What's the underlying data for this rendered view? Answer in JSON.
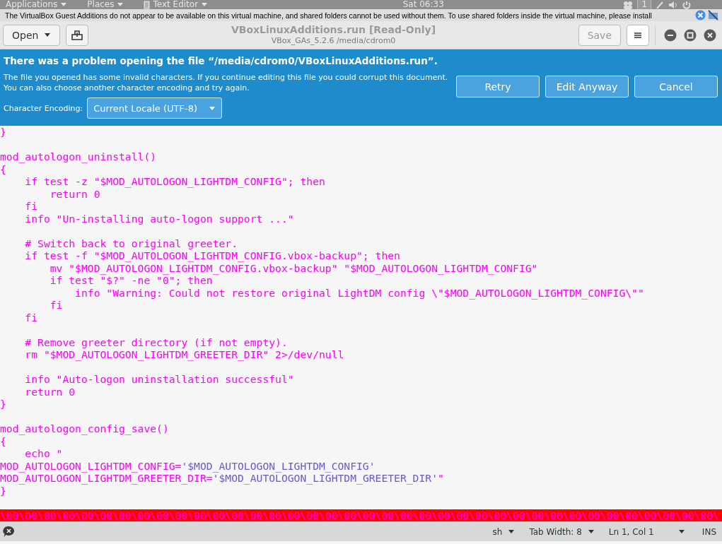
{
  "top_bar": {
    "menus": [
      {
        "label": "Applications",
        "dropdown": true
      },
      {
        "label": "Places",
        "dropdown": true
      },
      {
        "label": "Text Editor",
        "dropdown": true
      }
    ],
    "clock": "Sat 06:33",
    "workspace": "1"
  },
  "notification": {
    "text": "The VirtualBox Guest Additions do not appear to be available on this virtual machine, and shared folders cannot be used without them. To use shared folders inside the virtual machine, please install"
  },
  "header": {
    "open_button": "Open",
    "title": "VBoxLinuxAdditions.run [Read-Only]",
    "subtitle": "VBox_GAs_5.2.6 /media/cdrom0",
    "save_button": {
      "label": "Save",
      "disabled": true
    }
  },
  "info_bar": {
    "title": "There was a problem opening the file “/media/cdrom0/VBoxLinuxAdditions.run”.",
    "message_lines": [
      "The file you opened has some invalid characters. If you continue editing this file you could corrupt this document.",
      "You can also choose another character encoding and try again."
    ],
    "encoding_label": "Character Encoding:",
    "encoding_value": "Current Locale (UTF-8)",
    "buttons": [
      "Retry",
      "Edit Anyway",
      "Cancel"
    ]
  },
  "editor": {
    "lines": [
      {
        "kind": "code",
        "segments": [
          {
            "kind": "text",
            "text": "}"
          }
        ]
      },
      {
        "kind": "blank"
      },
      {
        "kind": "code",
        "segments": [
          {
            "kind": "text",
            "text": "mod_autologon_uninstall()"
          }
        ]
      },
      {
        "kind": "code",
        "segments": [
          {
            "kind": "text",
            "text": "{"
          }
        ]
      },
      {
        "kind": "code",
        "segments": [
          {
            "kind": "text",
            "text": "    if test -z \"$MOD_AUTOLOGON_LIGHTDM_CONFIG\"; then"
          }
        ]
      },
      {
        "kind": "code",
        "segments": [
          {
            "kind": "text",
            "text": "        return 0"
          }
        ]
      },
      {
        "kind": "code",
        "segments": [
          {
            "kind": "text",
            "text": "    fi"
          }
        ]
      },
      {
        "kind": "code",
        "segments": [
          {
            "kind": "text",
            "text": "    info \"Un-installing auto-logon support ...\""
          }
        ]
      },
      {
        "kind": "blank"
      },
      {
        "kind": "code",
        "segments": [
          {
            "kind": "text",
            "text": "    # Switch back to original greeter."
          }
        ]
      },
      {
        "kind": "code",
        "segments": [
          {
            "kind": "text",
            "text": "    if test -f \"$MOD_AUTOLOGON_LIGHTDM_CONFIG.vbox-backup\"; then"
          }
        ]
      },
      {
        "kind": "code",
        "segments": [
          {
            "kind": "text",
            "text": "        mv \"$MOD_AUTOLOGON_LIGHTDM_CONFIG.vbox-backup\" \"$MOD_AUTOLOGON_LIGHTDM_CONFIG\""
          }
        ]
      },
      {
        "kind": "code",
        "segments": [
          {
            "kind": "text",
            "text": "        if test \"$?\" -ne \"0\"; then"
          }
        ]
      },
      {
        "kind": "code",
        "segments": [
          {
            "kind": "text",
            "text": "            info \"Warning: Could not restore original LightDM config \\\"$MOD_AUTOLOGON_LIGHTDM_CONFIG\\\"\""
          }
        ]
      },
      {
        "kind": "code",
        "segments": [
          {
            "kind": "text",
            "text": "        fi"
          }
        ]
      },
      {
        "kind": "code",
        "segments": [
          {
            "kind": "text",
            "text": "    fi"
          }
        ]
      },
      {
        "kind": "blank"
      },
      {
        "kind": "code",
        "segments": [
          {
            "kind": "text",
            "text": "    # Remove greeter directory (if not empty)."
          }
        ]
      },
      {
        "kind": "code",
        "segments": [
          {
            "kind": "text",
            "text": "    rm \"$MOD_AUTOLOGON_LIGHTDM_GREETER_DIR\" 2>/dev/null"
          }
        ]
      },
      {
        "kind": "blank"
      },
      {
        "kind": "code",
        "segments": [
          {
            "kind": "text",
            "text": "    info \"Auto-logon uninstallation successful\""
          }
        ]
      },
      {
        "kind": "code",
        "segments": [
          {
            "kind": "text",
            "text": "    return 0"
          }
        ]
      },
      {
        "kind": "code",
        "segments": [
          {
            "kind": "text",
            "text": "}"
          }
        ]
      },
      {
        "kind": "blank"
      },
      {
        "kind": "code",
        "segments": [
          {
            "kind": "text",
            "text": "mod_autologon_config_save()"
          }
        ]
      },
      {
        "kind": "code",
        "segments": [
          {
            "kind": "text",
            "text": "{"
          }
        ]
      },
      {
        "kind": "code",
        "segments": [
          {
            "kind": "text",
            "text": "    echo \""
          }
        ]
      },
      {
        "kind": "code",
        "segments": [
          {
            "kind": "text",
            "text": "MOD_AUTOLOGON_LIGHTDM_CONFIG="
          },
          {
            "kind": "variable",
            "text": "'$MOD_AUTOLOGON_LIGHTDM_CONFIG'"
          }
        ]
      },
      {
        "kind": "code",
        "segments": [
          {
            "kind": "text",
            "text": "MOD_AUTOLOGON_LIGHTDM_GREETER_DIR="
          },
          {
            "kind": "variable",
            "text": "'$MOD_AUTOLOGON_LIGHTDM_GREETER_DIR'"
          },
          {
            "kind": "text",
            "text": "\""
          }
        ]
      },
      {
        "kind": "code",
        "segments": [
          {
            "kind": "text",
            "text": "}"
          }
        ]
      },
      {
        "kind": "blank"
      },
      {
        "kind": "error",
        "segments": [
          {
            "kind": "text",
            "text": "\\00\\00\\00\\00\\00\\00\\00\\00\\00\\00\\00\\00\\00\\00\\00\\00\\00\\00\\00\\00\\00\\00\\00\\00\\00\\00\\00\\00\\00\\00\\00\\00\\00\\00\\00\\00\\00\\00\\"
          }
        ]
      }
    ]
  },
  "status_bar": {
    "language": "sh",
    "tab_width": "Tab Width: 8",
    "position": "Ln 1, Col 1",
    "mode": "INS"
  }
}
